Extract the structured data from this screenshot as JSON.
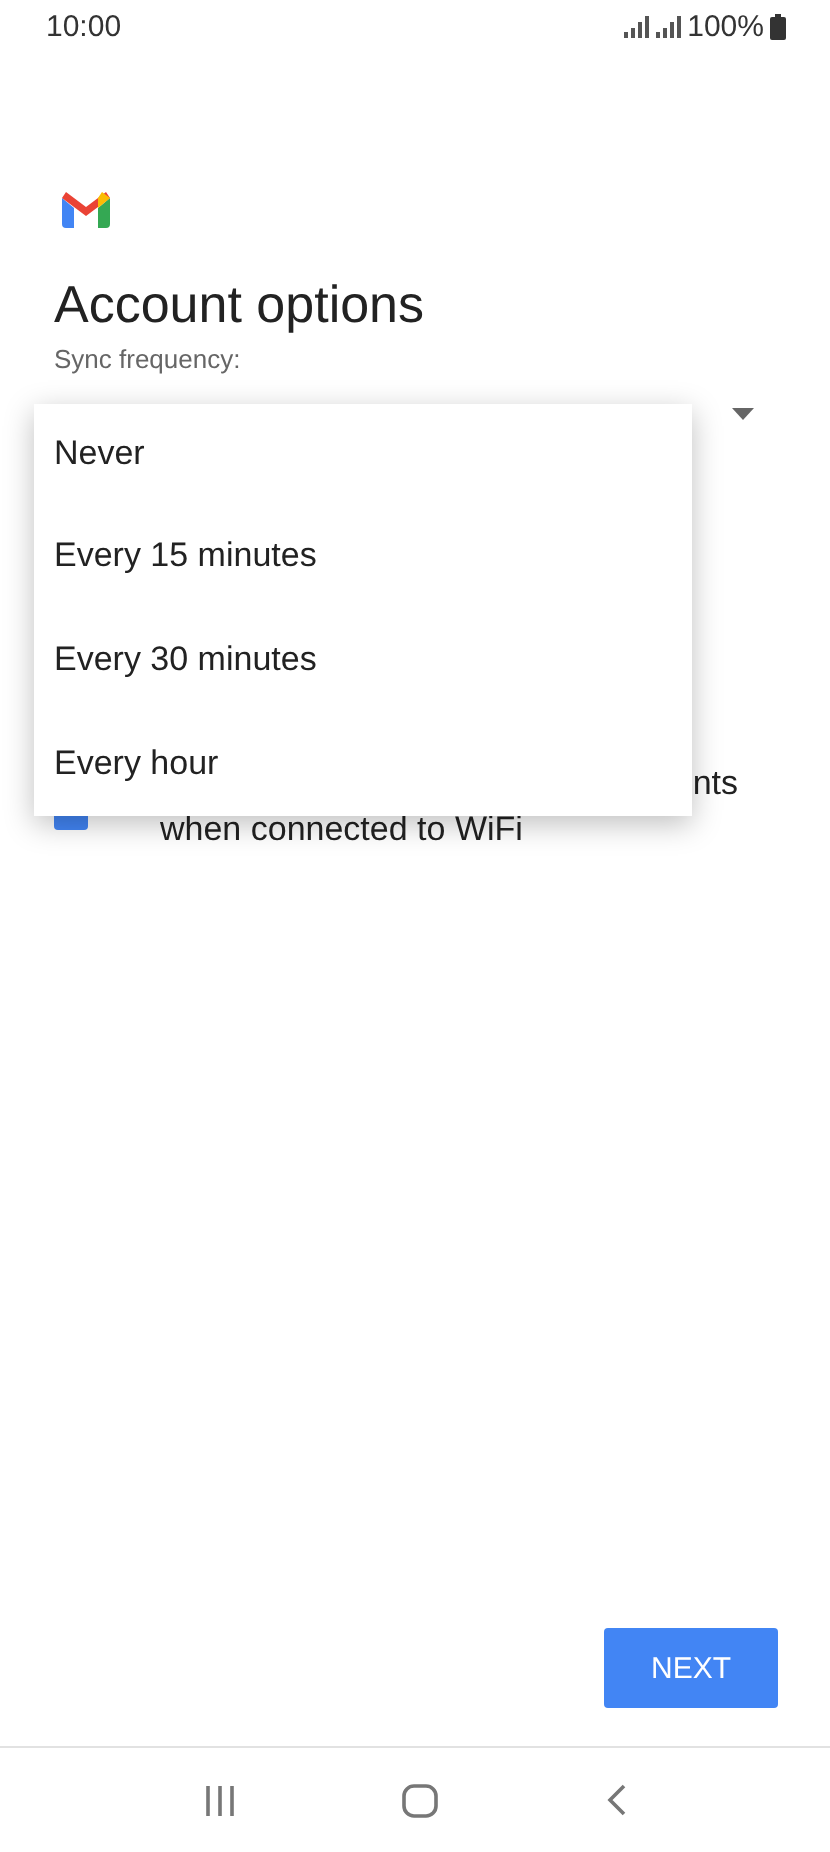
{
  "status_bar": {
    "time": "10:00",
    "battery": "100%"
  },
  "title": "Account options",
  "sync_frequency": {
    "label": "Sync frequency:"
  },
  "checkbox_row": {
    "checked": true,
    "lines": [
      "nts",
      "when connected to WiFi"
    ]
  },
  "dropdown": {
    "options": [
      {
        "label": "Never"
      },
      {
        "label": "Every 15 minutes"
      },
      {
        "label": "Every 30 minutes"
      },
      {
        "label": "Every hour"
      }
    ]
  },
  "next_button": "NEXT"
}
